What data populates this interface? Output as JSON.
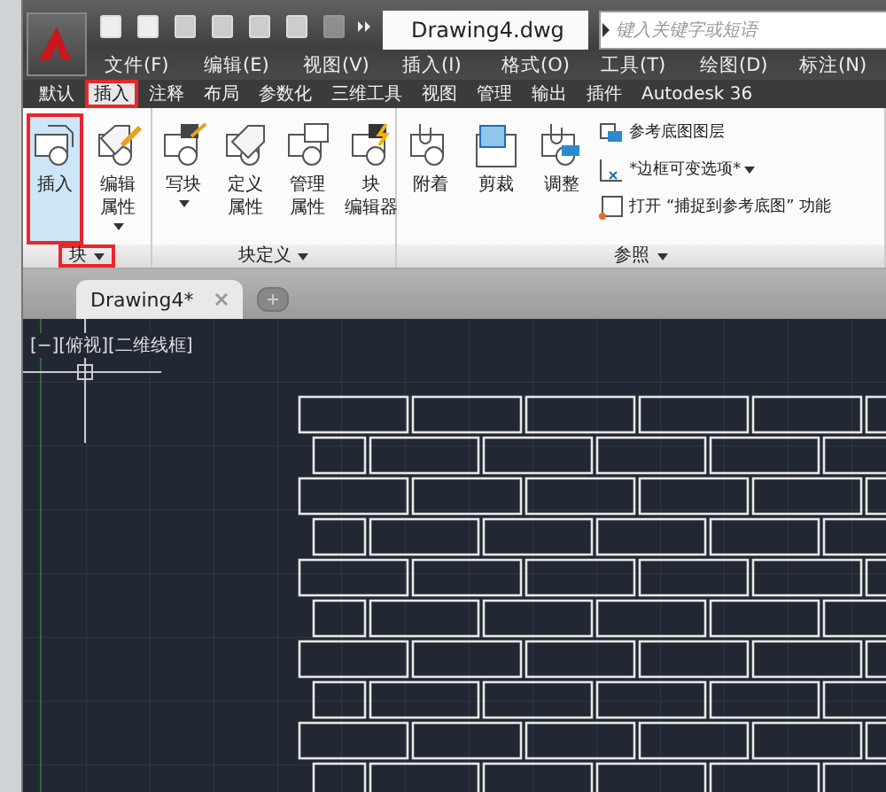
{
  "title_bar": {
    "document_title": "Drawing4.dwg",
    "search": {
      "placeholder": "键入关键字或短语"
    }
  },
  "menu": [
    "文件(F)",
    "编辑(E)",
    "视图(V)",
    "插入(I)",
    "格式(O)",
    "工具(T)",
    "绘图(D)",
    "标注(N)"
  ],
  "ribbon_tabs": [
    {
      "label": "默认",
      "selected": false,
      "highlighted": false
    },
    {
      "label": "插入",
      "selected": true,
      "highlighted": true
    },
    {
      "label": "注释",
      "selected": false,
      "highlighted": false
    },
    {
      "label": "布局",
      "selected": false,
      "highlighted": false
    },
    {
      "label": "参数化",
      "selected": false,
      "highlighted": false
    },
    {
      "label": "三维工具",
      "selected": false,
      "highlighted": false
    },
    {
      "label": "视图",
      "selected": false,
      "highlighted": false
    },
    {
      "label": "管理",
      "selected": false,
      "highlighted": false
    },
    {
      "label": "输出",
      "selected": false,
      "highlighted": false
    },
    {
      "label": "插件",
      "selected": false,
      "highlighted": false
    },
    {
      "label": "Autodesk 36",
      "selected": false,
      "highlighted": false
    }
  ],
  "panels": [
    {
      "title": "块",
      "highlighted": true,
      "buttons": [
        {
          "kind": "insert",
          "label": [
            "插入"
          ],
          "dropdown": false,
          "selected": true,
          "highlighted": true
        },
        {
          "kind": "tag-edit",
          "label": [
            "编辑",
            "属性"
          ],
          "dropdown": true,
          "selected": false,
          "highlighted": false
        }
      ]
    },
    {
      "title": "块定义",
      "highlighted": false,
      "buttons": [
        {
          "kind": "write",
          "label": [
            "写块"
          ],
          "dropdown": true,
          "selected": false,
          "highlighted": false
        },
        {
          "kind": "tag",
          "label": [
            "定义",
            "属性"
          ],
          "dropdown": false,
          "selected": false,
          "highlighted": false
        },
        {
          "kind": "manage",
          "label": [
            "管理",
            "属性"
          ],
          "dropdown": false,
          "selected": false,
          "highlighted": false
        },
        {
          "kind": "editor",
          "label": [
            "块",
            "编辑器"
          ],
          "dropdown": false,
          "selected": false,
          "highlighted": false
        }
      ]
    },
    {
      "title": "参照",
      "highlighted": false,
      "buttons": [
        {
          "kind": "attach",
          "label": [
            "附着"
          ],
          "dropdown": false,
          "selected": false,
          "highlighted": false
        },
        {
          "kind": "clip",
          "label": [
            "剪裁"
          ],
          "dropdown": false,
          "selected": false,
          "highlighted": false
        },
        {
          "kind": "adjust",
          "label": [
            "调整"
          ],
          "dropdown": false,
          "selected": false,
          "highlighted": false
        }
      ],
      "rows": [
        {
          "kind": "layers",
          "label": "参考底图图层"
        },
        {
          "kind": "frame",
          "label": "*边框可变选项*",
          "dropdown": true
        },
        {
          "kind": "snap",
          "label": "打开 “捕捉到参考底图” 功能"
        }
      ]
    }
  ],
  "doc_tabs": [
    {
      "label": "Drawing4*",
      "selected": true
    }
  ],
  "viewport": {
    "label": "[−][俯视][二维线框]"
  }
}
